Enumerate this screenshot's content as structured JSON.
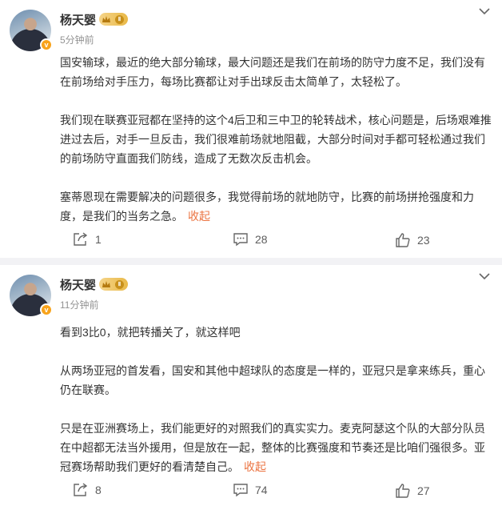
{
  "posts": [
    {
      "author": "杨天婴",
      "level": "Ⅱ",
      "time": "5分钟前",
      "paragraphs": [
        "国安输球，最近的绝大部分输球，最大问题还是我们在前场的防守力度不足，我们没有在前场给对手压力，每场比赛都让对手出球反击太简单了，太轻松了。",
        "我们现在联赛亚冠都在坚持的这个4后卫和三中卫的轮转战术，核心问题是，后场艰难推进过去后，对手一旦反击，我们很难前场就地阻截，大部分时间对手都可轻松通过我们的前场防守直面我们防线，造成了无数次反击机会。",
        "塞蒂恩现在需要解决的问题很多，我觉得前场的就地防守，比赛的前场拼抢强度和力度，是我们的当务之急。"
      ],
      "collapse_label": "收起",
      "reposts": "1",
      "comments": "28",
      "likes": "23"
    },
    {
      "author": "杨天婴",
      "level": "Ⅱ",
      "time": "11分钟前",
      "paragraphs": [
        "看到3比0，就把转播关了，就这样吧",
        "从两场亚冠的首发看，国安和其他中超球队的态度是一样的，亚冠只是拿来练兵，重心仍在联赛。",
        "只是在亚洲赛场上，我们能更好的对照我们的真实实力。麦克阿瑟这个队的大部分队员在中超都无法当外援用，但是放在一起，整体的比赛强度和节奏还是比咱们强很多。亚冠赛场帮助我们更好的看清楚自己。"
      ],
      "collapse_label": "收起",
      "reposts": "8",
      "comments": "74",
      "likes": "27"
    }
  ],
  "icons": {
    "verified": "v-badge-icon",
    "more": "chevron-down-icon",
    "repost": "share-icon",
    "comment": "comment-icon",
    "like": "thumb-up-icon"
  },
  "colors": {
    "accent": "#eb7340",
    "muted": "#939393",
    "text": "#333333",
    "separator": "#f2f2f5",
    "level_badge": "#e9b948"
  }
}
